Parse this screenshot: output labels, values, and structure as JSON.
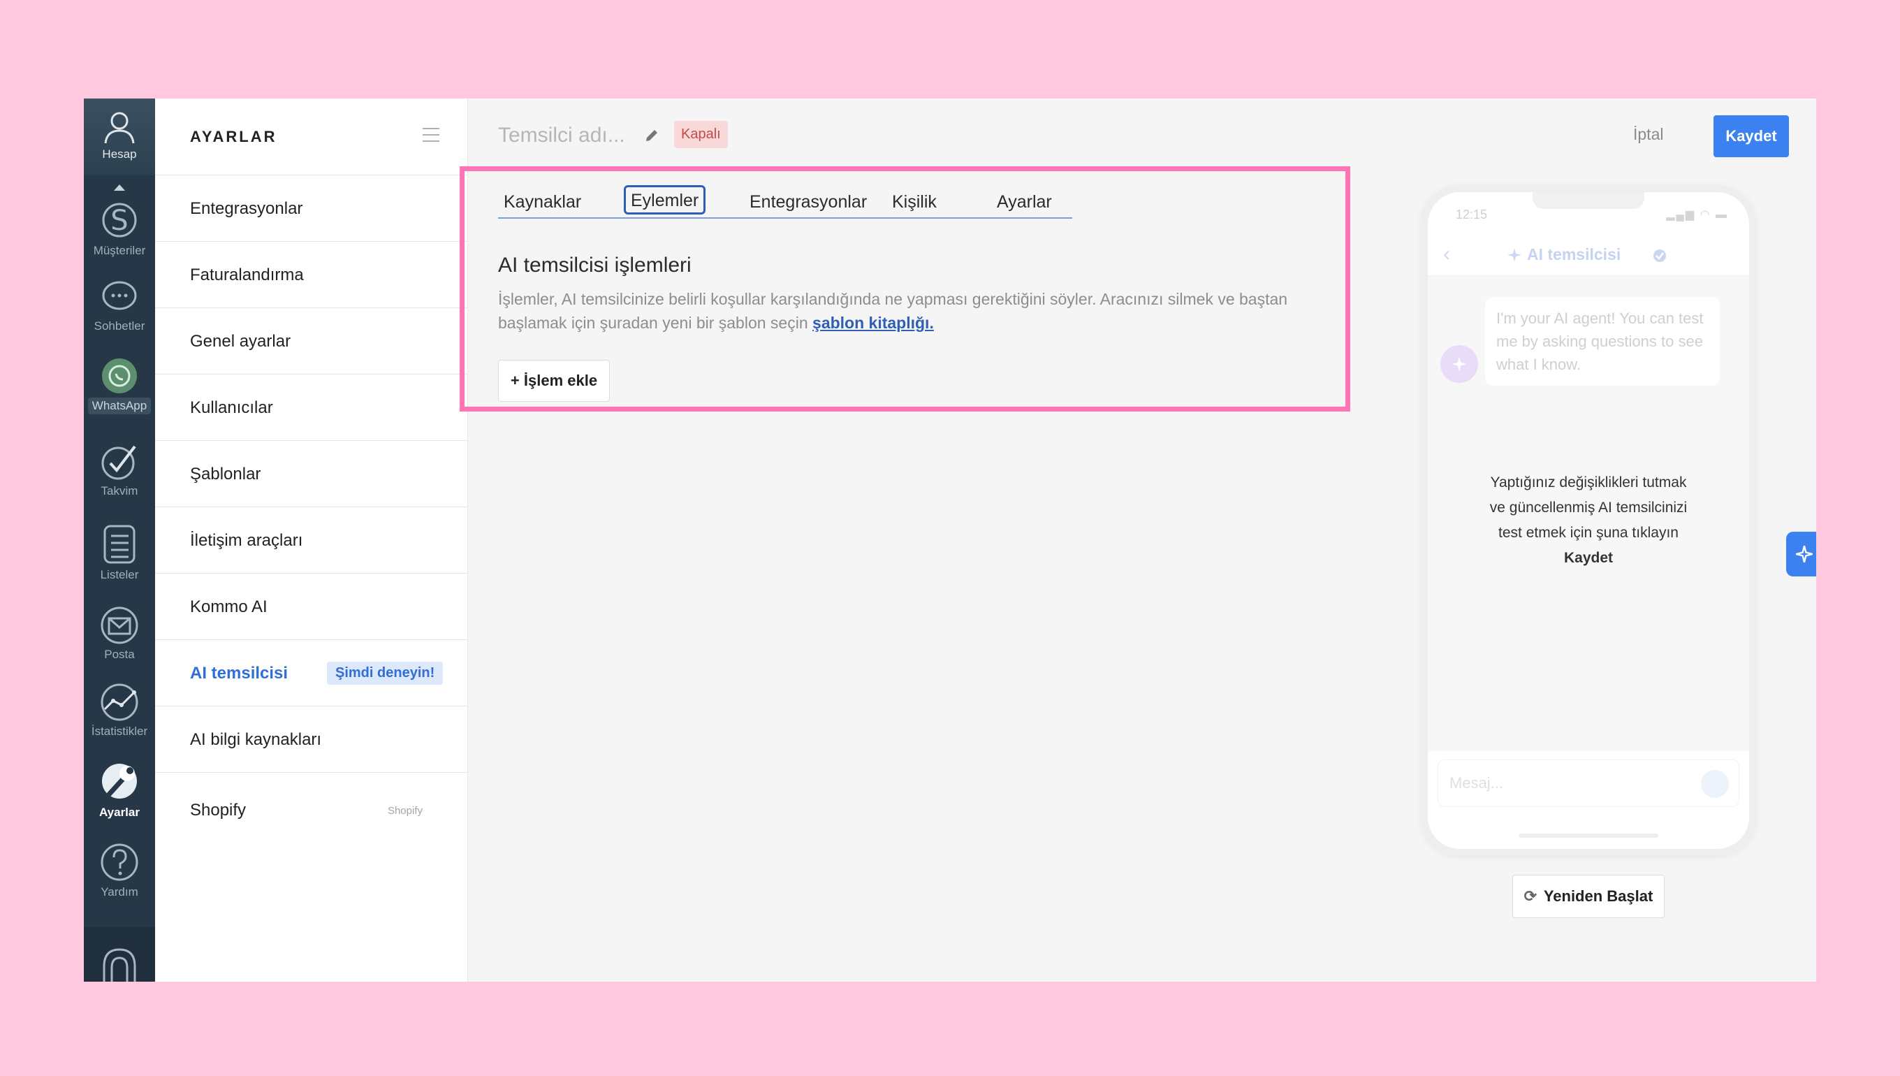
{
  "rail": {
    "items": [
      {
        "label": "Hesap"
      },
      {
        "label": "Müşteriler"
      },
      {
        "label": "Sohbetler"
      },
      {
        "label": "WhatsApp"
      },
      {
        "label": "Takvim"
      },
      {
        "label": "Listeler"
      },
      {
        "label": "Posta"
      },
      {
        "label": "İstatistikler"
      },
      {
        "label": "Ayarlar"
      },
      {
        "label": "Yardım"
      }
    ]
  },
  "settings": {
    "title": "AYARLAR",
    "items": [
      {
        "label": "Entegrasyonlar"
      },
      {
        "label": "Faturalandırma"
      },
      {
        "label": "Genel ayarlar"
      },
      {
        "label": "Kullanıcılar"
      },
      {
        "label": "Şablonlar"
      },
      {
        "label": "İletişim araçları"
      },
      {
        "label": "Kommo AI"
      },
      {
        "label": "AI temsilcisi",
        "badge": "Şimdi deneyin!"
      },
      {
        "label": "AI bilgi kaynakları"
      },
      {
        "label": "Shopify",
        "tag": "Shopify"
      }
    ]
  },
  "header": {
    "agent_name_placeholder": "Temsilci adı...",
    "status": "Kapalı",
    "cancel": "İptal",
    "save": "Kaydet"
  },
  "tabs": [
    {
      "label": "Kaynaklar"
    },
    {
      "label": "Eylemler",
      "active": true
    },
    {
      "label": "Entegrasyonlar"
    },
    {
      "label": "Kişilik"
    },
    {
      "label": "Ayarlar"
    }
  ],
  "section": {
    "title": "AI temsilcisi işlemleri",
    "description_line1": "İşlemler, AI temsilcinize belirli koşullar karşılandığında ne yapması gerektiğini söyler. Aracınızı silmek ve baştan",
    "description_line2": "başlamak için şuradan yeni bir şablon seçin",
    "link": "şablon kitaplığı.",
    "add_button": "+ İşlem ekle"
  },
  "phone": {
    "time": "12:15",
    "title": "AI temsilcisi",
    "bubble": "I'm your AI agent! You can test me by asking questions to see what I know.",
    "message_lines": [
      "Yaptığınız değişiklikleri tutmak",
      "ve güncellenmiş AI temsilcinizi",
      "test etmek için şuna tıklayın"
    ],
    "message_bold": "Kaydet",
    "input_placeholder": "Mesaj..."
  },
  "restart_button": "Yeniden Başlat",
  "colors": {
    "accent": "#3b82f0",
    "highlight": "#ff74b4",
    "background": "#ffc8df",
    "rail": "#263848"
  }
}
